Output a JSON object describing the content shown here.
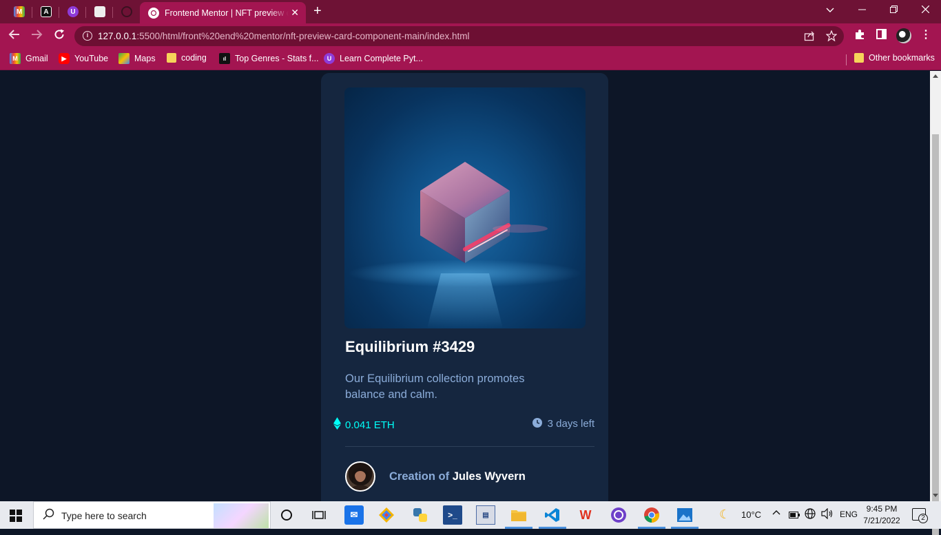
{
  "browser": {
    "active_tab_title": "Frontend Mentor | NFT preview card component",
    "url_host": "127.0.0.1",
    "url_rest": ":5500/html/front%20end%20mentor/nft-preview-card-component-main/index.html",
    "bookmarks": [
      "Gmail",
      "YouTube",
      "Maps",
      "coding",
      "Top Genres - Stats f...",
      "Learn Complete Pyt..."
    ],
    "other_bookmarks": "Other bookmarks"
  },
  "card": {
    "title": "Equilibrium #3429",
    "description": "Our Equilibrium collection promotes balance and calm.",
    "price": "0.041 ETH",
    "time_left": "3 days left",
    "creator_prefix": "Creation of",
    "creator_name": "Jules Wyvern"
  },
  "taskbar": {
    "search_placeholder": "Type here to search",
    "temperature": "10°C",
    "language": "ENG",
    "time": "9:45 PM",
    "date": "7/21/2022",
    "notification_count": "2"
  },
  "colors": {
    "page_bg": "#0d1627",
    "card_bg": "#15263f",
    "cyan": "#00fff8",
    "soft_blue": "#8bacd9",
    "chrome": "#a31551"
  }
}
